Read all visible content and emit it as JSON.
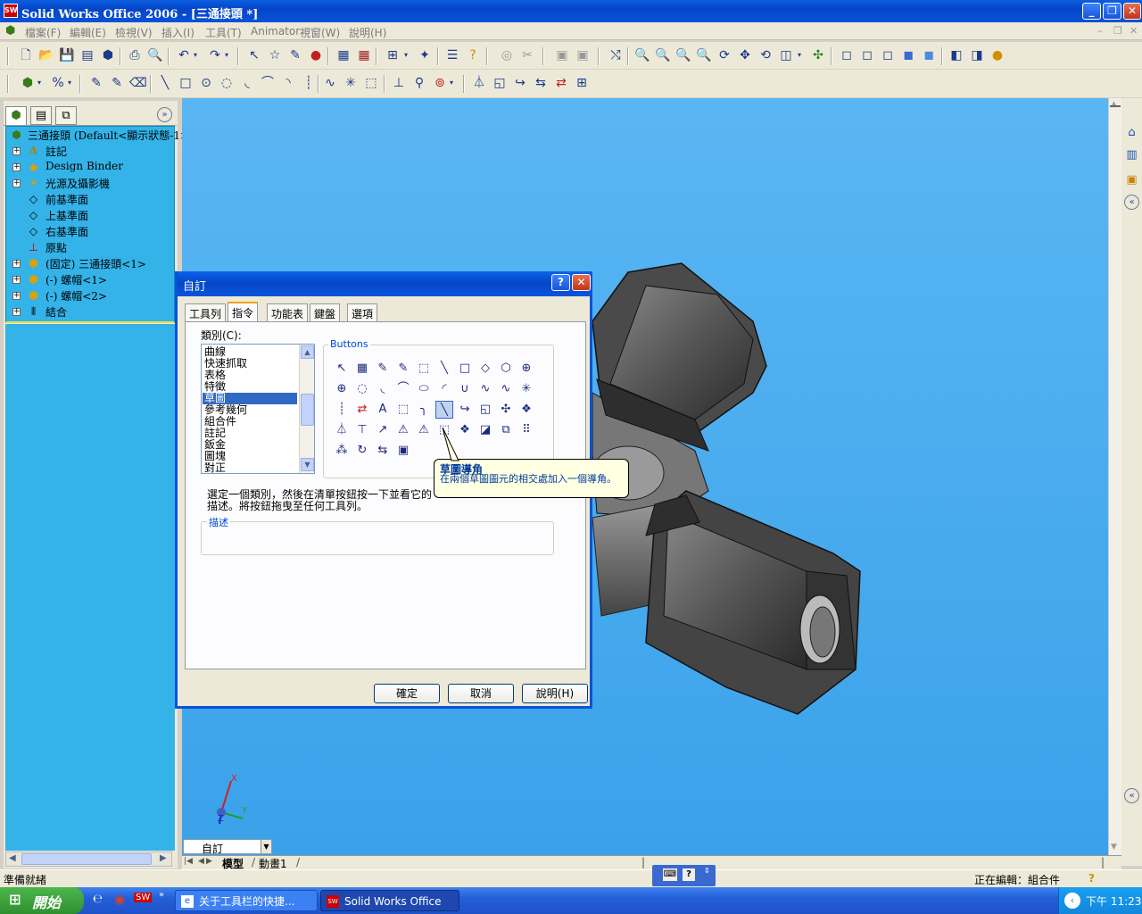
{
  "window": {
    "title": "Solid Works Office 2006 - [三通接頭 *]",
    "app_icon": "SW"
  },
  "menubar": {
    "items": [
      "檔案(F)",
      "編輯(E)",
      "檢視(V)",
      "插入(I)",
      "工具(T)",
      "Animator",
      "視窗(W)",
      "說明(H)"
    ]
  },
  "feature_tree": {
    "tabs": [
      "feature-manager",
      "property-manager",
      "configuration-manager"
    ],
    "root": "三通接頭  (Default<顯示狀態-1>",
    "items": [
      "註記",
      "Design Binder",
      "光源及攝影機",
      "前基準面",
      "上基準面",
      "右基準面",
      "原點",
      "(固定) 三通接頭<1>",
      "(-) 螺帽<1>",
      "(-) 螺帽<2>",
      "結合"
    ]
  },
  "bottom": {
    "config_select": "自訂",
    "tabs": [
      "模型",
      "動畫1"
    ]
  },
  "status": {
    "left": "準備就緒",
    "right": "正在編輯：組合件"
  },
  "taskbar": {
    "start": "開始",
    "tasks": [
      "关于工具栏的快捷...",
      "Solid Works Office 20..."
    ],
    "clock": "下午 11:23"
  },
  "triad": {
    "x": "X",
    "y": "Y",
    "z": "Z"
  },
  "dialog": {
    "title": "自訂",
    "tabs": [
      "工具列",
      "指令",
      "功能表",
      "鍵盤",
      "選項"
    ],
    "category_label": "類別(C):",
    "categories": [
      "曲線",
      "快速抓取",
      "表格",
      "特徵",
      "草圖",
      "參考幾何",
      "組合件",
      "註記",
      "鈑金",
      "圖塊",
      "對正"
    ],
    "selected_category": "草圖",
    "buttons_label": "Buttons",
    "instruction": "選定一個類別，然後在清單按鈕按一下並看它的描述。將按鈕拖曳至任何工具列。",
    "description_label": "描述",
    "tooltip_title": "草圖導角",
    "tooltip_text": "在兩個草圖圖元的相交處加入一個導角。",
    "ok": "確定",
    "cancel": "取消",
    "help": "說明(H)"
  },
  "colors": {
    "viewport": "#4aaef0",
    "tree_bg": "#33b3e8",
    "title_blue": "#0a52d8",
    "selection": "#316ac5"
  }
}
